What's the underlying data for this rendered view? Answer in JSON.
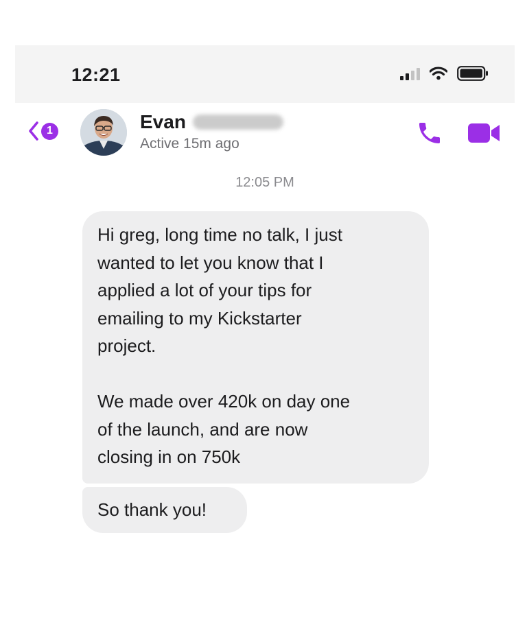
{
  "status_bar": {
    "time": "12:21",
    "signal_icon": "cellular-signal-icon",
    "wifi_icon": "wifi-icon",
    "battery_icon": "battery-icon"
  },
  "header": {
    "back_icon": "chevron-left-icon",
    "unread_count": "1",
    "avatar": "contact-avatar",
    "contact_name": "Evan",
    "active_status": "Active 15m ago",
    "call_icon": "phone-icon",
    "video_icon": "video-camera-icon"
  },
  "conversation": {
    "timestamp": "12:05 PM",
    "messages": [
      {
        "sender": "contact",
        "text": "Hi greg, long time no talk, I just\nwanted to let you know that I\napplied a lot of your tips for\nemailing to my Kickstarter\nproject.\n\nWe made over 420k on day one\nof the launch, and are now\nclosing in on 750k"
      },
      {
        "sender": "contact",
        "text": "So thank you!"
      }
    ]
  },
  "colors": {
    "accent": "#9b2fe6",
    "bubble_incoming": "#eeeeef",
    "status_bar_bg": "#f4f4f4",
    "secondary_text": "#8a8a8e"
  }
}
